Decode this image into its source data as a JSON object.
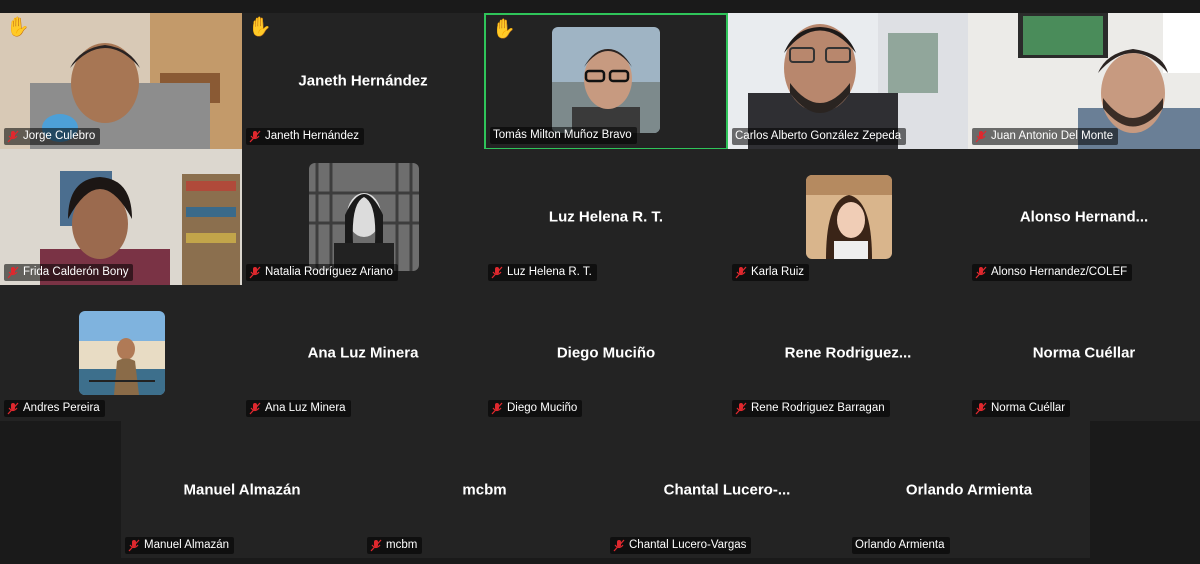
{
  "participants": [
    {
      "name": "Jorge Culebro",
      "display": "",
      "muted": true,
      "hand": true,
      "video": true
    },
    {
      "name": "Janeth Hernández",
      "display": "Janeth Hernández",
      "muted": true,
      "hand": true,
      "video": false
    },
    {
      "name": "Tomás Milton Muñoz Bravo",
      "display": "",
      "muted": false,
      "hand": true,
      "video": false,
      "avatar": true,
      "speaker": true
    },
    {
      "name": "Carlos Alberto González Zepeda",
      "display": "",
      "muted": false,
      "hand": false,
      "video": true
    },
    {
      "name": "Juan Antonio Del Monte",
      "display": "",
      "muted": true,
      "hand": false,
      "video": true
    },
    {
      "name": "Frida Calderón Bony",
      "display": "",
      "muted": true,
      "hand": false,
      "video": true
    },
    {
      "name": "Natalia Rodríguez Ariano",
      "display": "",
      "muted": true,
      "hand": false,
      "video": false,
      "avatar": true
    },
    {
      "name": "Luz Helena R. T.",
      "display": "Luz Helena R. T.",
      "muted": true,
      "hand": false,
      "video": false
    },
    {
      "name": "Karla Ruiz",
      "display": "",
      "muted": true,
      "hand": false,
      "video": false,
      "avatar": true
    },
    {
      "name": "Alonso Hernandez/COLEF",
      "display": "Alonso  Hernand...",
      "muted": true,
      "hand": false,
      "video": false
    },
    {
      "name": "Andres Pereira",
      "display": "",
      "muted": true,
      "hand": false,
      "video": false,
      "avatar": true
    },
    {
      "name": "Ana Luz Minera",
      "display": "Ana Luz Minera",
      "muted": true,
      "hand": false,
      "video": false
    },
    {
      "name": "Diego Muciño",
      "display": "Diego Muciño",
      "muted": true,
      "hand": false,
      "video": false
    },
    {
      "name": "Rene Rodriguez Barragan",
      "display": "Rene  Rodriguez...",
      "muted": true,
      "hand": false,
      "video": false
    },
    {
      "name": "Norma Cuéllar",
      "display": "Norma Cuéllar",
      "muted": true,
      "hand": false,
      "video": false
    },
    {
      "name": "Manuel Almazán",
      "display": "Manuel Almazán",
      "muted": true,
      "hand": false,
      "video": false
    },
    {
      "name": "mcbm",
      "display": "mcbm",
      "muted": true,
      "hand": false,
      "video": false
    },
    {
      "name": "Chantal Lucero-Vargas",
      "display": "Chantal  Lucero-...",
      "muted": true,
      "hand": false,
      "video": false
    },
    {
      "name": "Orlando Armienta",
      "display": "Orlando Armienta",
      "muted": false,
      "hand": false,
      "video": false
    }
  ],
  "icons": {
    "hand": "raised-hand-icon",
    "mic": "mic-muted-icon"
  },
  "colors": {
    "speaker_border": "#2fc45a",
    "tile_bg": "#232323",
    "mic_muted": "#e0282e",
    "hand": "#f5c400"
  }
}
